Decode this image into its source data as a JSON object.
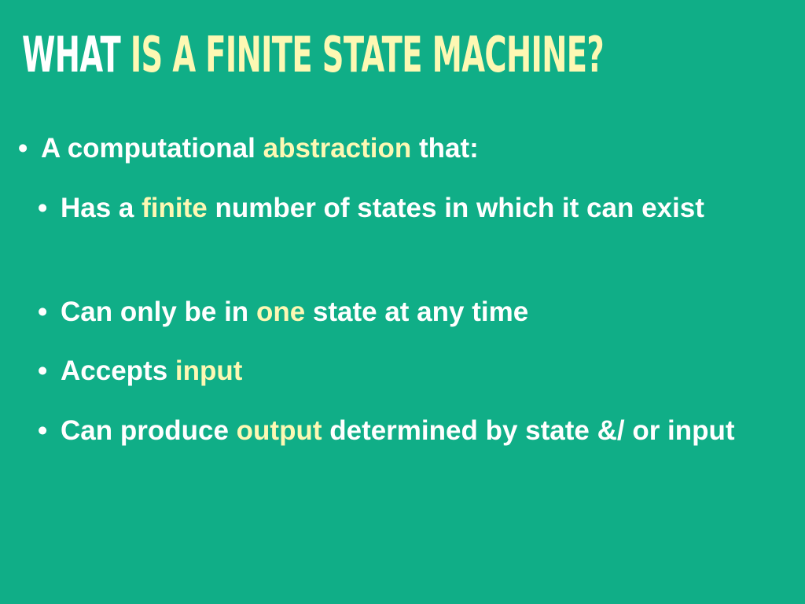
{
  "slide": {
    "title": {
      "lead": "WHAT",
      "highlight": "IS A FINITE STATE MACHINE?"
    },
    "bullets": [
      {
        "before": "A computational",
        "highlight": "abstraction",
        "after": "that:"
      },
      {
        "before": "Has a",
        "highlight": "finite",
        "after": "number of states in which it can exist"
      },
      {
        "before": "Can only be in",
        "highlight": "one",
        "after": "state at any time"
      },
      {
        "before": "Accepts",
        "highlight": "input",
        "after": ""
      },
      {
        "before": "Can produce",
        "highlight": "output",
        "after": "determined by state &/ or input"
      }
    ],
    "bullet_glyph": "•"
  },
  "colors": {
    "background": "#10ae87",
    "text": "#ffffff",
    "highlight": "#fdf8b3"
  }
}
